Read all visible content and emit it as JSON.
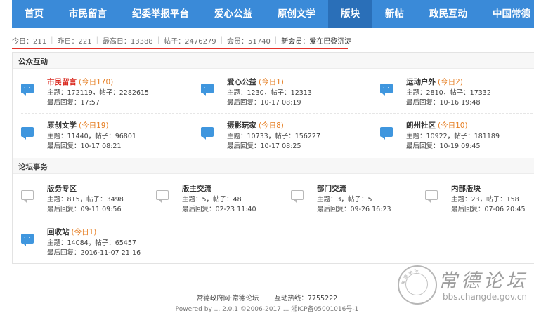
{
  "nav": {
    "items": [
      {
        "label": "首页"
      },
      {
        "label": "市民留言"
      },
      {
        "label": "纪委举报平台"
      },
      {
        "label": "爱心公益"
      },
      {
        "label": "原创文学"
      },
      {
        "label": "版块",
        "active": true
      },
      {
        "label": "新帖"
      },
      {
        "label": "政民互动"
      },
      {
        "label": "中国常德"
      }
    ]
  },
  "stats": {
    "today": "今日：211",
    "yesterday": "昨日：221",
    "highest": "最高日：13388",
    "posts": "帖子：2476279",
    "members": "会员：51740",
    "newest_member": "新会员：爱在巴黎沉淀"
  },
  "sections": {
    "public": {
      "title": "公众互动",
      "forums": [
        {
          "name": "市民留言",
          "today": "(今日170)",
          "topics": "主题：172119，帖子：2282615",
          "last": "最后回复：17:57"
        },
        {
          "name": "爱心公益",
          "today": "(今日1)",
          "topics": "主题：1230，帖子：12313",
          "last": "最后回复：10-17 08:19"
        },
        {
          "name": "运动户外",
          "today": "(今日2)",
          "topics": "主题：2810，帖子：17332",
          "last": "最后回复：10-16 19:48"
        },
        {
          "name": "原创文学",
          "today": "(今日19)",
          "topics": "主题：11440，帖子：96801",
          "last": "最后回复：10-17 08:21"
        },
        {
          "name": "摄影玩家",
          "today": "(今日8)",
          "topics": "主题：10733，帖子：156227",
          "last": "最后回复：10-17 08:25"
        },
        {
          "name": "朗州社区",
          "today": "(今日10)",
          "topics": "主题：10922，帖子：181189",
          "last": "最后回复：10-19 09:45"
        }
      ]
    },
    "affairs": {
      "title": "论坛事务",
      "forums": [
        {
          "name": "版务专区",
          "today": "",
          "topics": "主题：815，帖子：3498",
          "last": "最后回复：09-11 09:56"
        },
        {
          "name": "版主交流",
          "today": "",
          "topics": "主题：5，帖子：48",
          "last": "最后回复：02-23 11:40"
        },
        {
          "name": "部门交流",
          "today": "",
          "topics": "主题：3，帖子：5",
          "last": "最后回复：09-26 16:23"
        },
        {
          "name": "内部版块",
          "today": "",
          "topics": "主题：23，帖子：158",
          "last": "最后回复：07-06 20:45"
        },
        {
          "name": "回收站",
          "today": "(今日1)",
          "topics": "主题：14084，帖子：65457",
          "last": "最后回复：2016-11-07 21:16"
        }
      ]
    }
  },
  "footer": {
    "site": "常德政府网·常德论坛",
    "hotline": "互动热线：7755222",
    "copyright": "Powered by ... 2.0.1 ©2006-2017 ... 湘ICP备05001016号-1"
  },
  "watermark": {
    "seal_text": "常 德 论 坛",
    "seal_url": "bbs.changde.gov.cn",
    "title": "常德论坛",
    "url": "bbs.changde.gov.cn"
  },
  "icons": {
    "forum_new": "chat-bubble-blue",
    "forum_old": "chat-bubble-gray"
  },
  "colors": {
    "nav": "#3a8ad8",
    "nav_active": "#2a6fb8",
    "today": "#e67e22",
    "hot": "#d9261c",
    "underline": "#e4322b"
  }
}
